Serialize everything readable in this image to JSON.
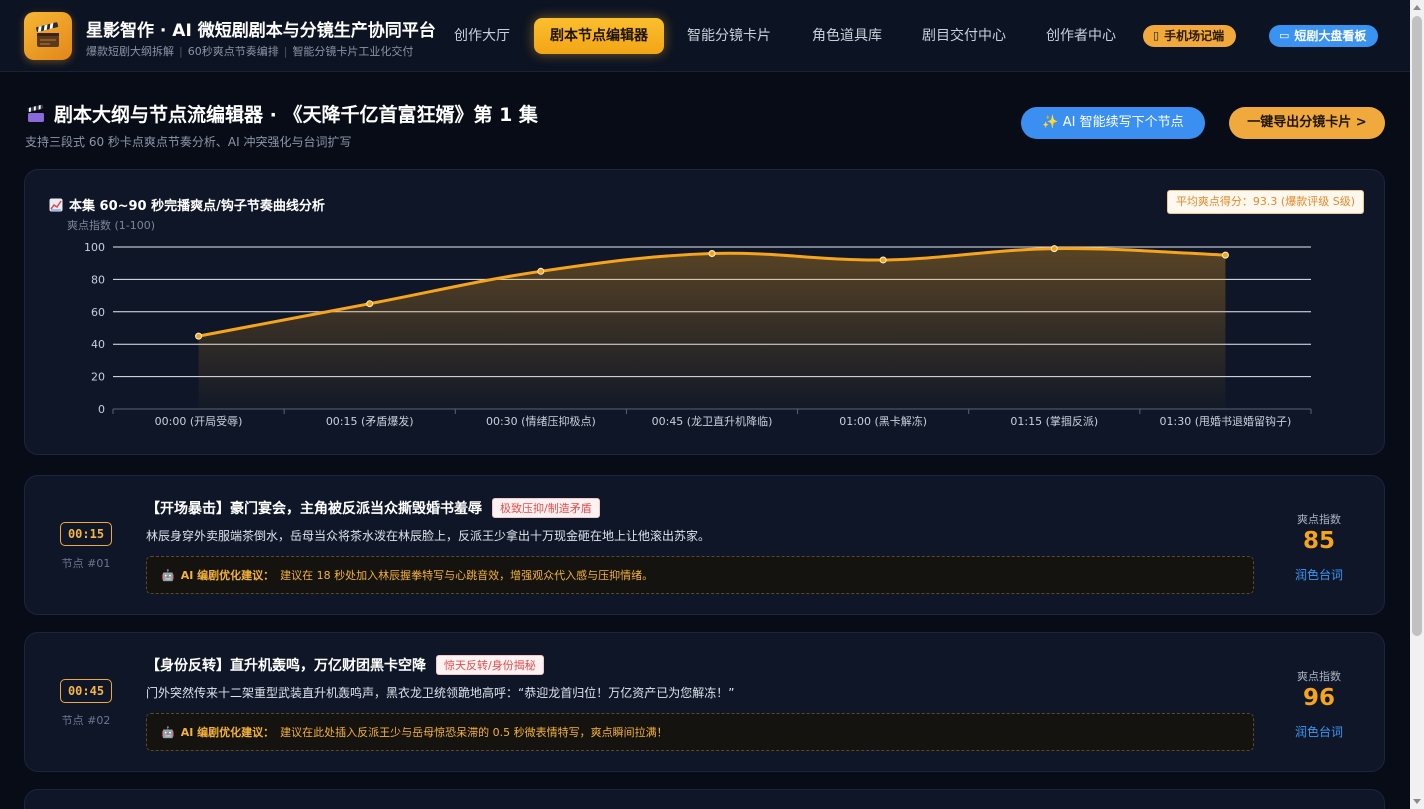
{
  "header": {
    "brand_title": "星影智作 · AI 微短剧剧本与分镜生产协同平台",
    "brand_sub_1": "爆款短剧大纲拆解",
    "brand_sub_2": "60秒爽点节奏编排",
    "brand_sub_3": "智能分镜卡片工业化交付",
    "logo_icon": "clapperboard-icon",
    "nav": [
      {
        "label": "创作大厅",
        "active": false
      },
      {
        "label": "剧本节点编辑器",
        "active": true
      },
      {
        "label": "智能分镜卡片",
        "active": false
      },
      {
        "label": "角色道具库",
        "active": false
      },
      {
        "label": "剧目交付中心",
        "active": false
      },
      {
        "label": "创作者中心",
        "active": false
      }
    ],
    "pill_mobile": "手机场记端",
    "pill_dashboard": "短剧大盘看板"
  },
  "page": {
    "title": "剧本大纲与节点流编辑器 · 《天降千亿首富狂婿》第 1 集",
    "subtitle": "支持三段式 60 秒卡点爽点节奏分析、AI 冲突强化与台词扩写",
    "btn_ai": "✨ AI 智能续写下个节点",
    "btn_export": "一键导出分镜卡片 >"
  },
  "chart_card": {
    "title": "本集 60~90 秒完播爽点/钩子节奏曲线分析",
    "avg_badge": "平均爽点得分：93.3 (爆款评级 S级)"
  },
  "chart_data": {
    "type": "line",
    "categories": [
      "00:00 (开局受辱)",
      "00:15 (矛盾爆发)",
      "00:30 (情绪压抑极点)",
      "00:45 (龙卫直升机降临)",
      "01:00 (黑卡解冻)",
      "01:15 (掌掴反派)",
      "01:30 (甩婚书退婚留钩子)"
    ],
    "values": [
      45,
      65,
      85,
      96,
      92,
      99,
      95
    ],
    "ylabel": "爽点指数 (1-100)",
    "yticks": [
      0,
      20,
      40,
      60,
      80,
      100
    ],
    "ylim": [
      0,
      100
    ],
    "grid": true,
    "line_color": "#f7a41d"
  },
  "nodes": [
    {
      "time": "00:15",
      "no": "节点 #01",
      "title": "【开场暴击】豪门宴会，主角被反派当众撕毁婚书羞辱",
      "tag": "极致压抑/制造矛盾",
      "desc": "林辰身穿外卖服端茶倒水，岳母当众将茶水泼在林辰脸上，反派王少拿出十万现金砸在地上让他滚出苏家。",
      "ai_label": "AI 编剧优化建议：",
      "ai_text": "建议在 18 秒处加入林辰握拳特写与心跳音效，增强观众代入感与压抑情绪。",
      "score_label": "爽点指数",
      "score": "85",
      "polish": "润色台词"
    },
    {
      "time": "00:45",
      "no": "节点 #02",
      "title": "【身份反转】直升机轰鸣，万亿财团黑卡空降",
      "tag": "惊天反转/身份揭秘",
      "desc": "门外突然传来十二架重型武装直升机轰鸣声，黑衣龙卫统领跪地高呼：“恭迎龙首归位！万亿资产已为您解冻！”",
      "ai_label": "AI 编剧优化建议：",
      "ai_text": "建议在此处插入反派王少与岳母惊恐呆滞的 0.5 秒微表情特写，爽点瞬间拉满！",
      "score_label": "爽点指数",
      "score": "96",
      "polish": "润色台词"
    }
  ]
}
